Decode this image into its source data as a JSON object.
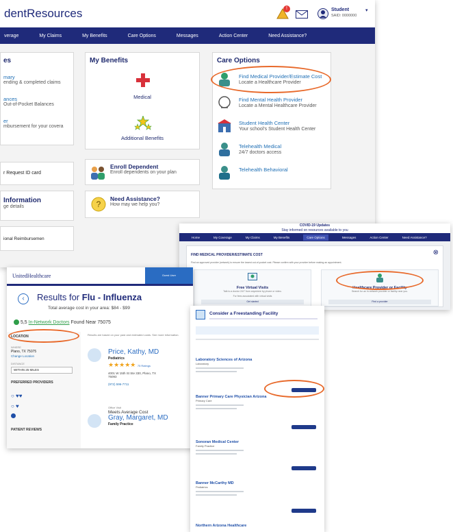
{
  "colors": {
    "navy": "#1f2a7a",
    "accent_orange": "#e8692a",
    "red_cross": "#d8313a",
    "green_stars": "#4aa83a"
  },
  "main": {
    "brand": "dentResources",
    "header": {
      "alert_badge": "!",
      "user_name": "Student",
      "user_id": "SAID: 0000000"
    },
    "nav": [
      "verage",
      "My Claims",
      "My Benefits",
      "Care Options",
      "Messages",
      "Action Center",
      "Need Assistance?"
    ],
    "left_col": {
      "heading": "es",
      "item1_title": "mary",
      "item1_sub": "ending & completed claims",
      "item2_title": "ances",
      "item2_sub": "Out-of-Pocket Balances",
      "item3_title": "er",
      "item3_sub": "mbursement for your covera",
      "id_card": "r Request ID card",
      "info_title": "Information",
      "info_sub": "ge details",
      "reimburse": "ional Reimbursemen"
    },
    "my_benefits": {
      "title": "My Benefits",
      "medical": "Medical",
      "additional": "Additional Benefits"
    },
    "enroll": {
      "title": "Enroll Dependent",
      "sub": "Enroll dependents on your plan"
    },
    "assist": {
      "title": "Need Assistance?",
      "sub": "How may we help you?"
    },
    "care_options": {
      "title": "Care Options",
      "items": [
        {
          "title": "Find Medical Provider/Estimate Cost",
          "sub": "Locate a Healthcare Provider"
        },
        {
          "title": "Find Mental Health Provider",
          "sub": "Locate a Mental Healthcare Provider"
        },
        {
          "title": "Student Health Center",
          "sub": "Your school's Student Health Center"
        },
        {
          "title": "Telehealth Medical",
          "sub": "24/7 doctors access"
        },
        {
          "title": "Telehealth Behavioral",
          "sub": ""
        }
      ]
    }
  },
  "modal": {
    "covid_title": "COVID-19 Updates",
    "covid_sub": "Stay informed on resources available to you",
    "nav": [
      "Home",
      "My Coverage",
      "My Claims",
      "My Benefits",
      "Care Options",
      "Messages",
      "Action Center",
      "Need Assistance?"
    ],
    "title": "FIND MEDICAL PROVIDER/ESTIMATE COST",
    "close": "⊗",
    "intro": "Find an approved provider (network) to ensure the lowest out-of-pocket cost. Please confirm with your provider before making an appointment.",
    "opt1": {
      "title": "Free Virtual Visits",
      "desc": "Talk to a doctor 24/7 from anywhere by phone or video.",
      "note": "For fees associated with virtual visits",
      "btn": "Get started"
    },
    "opt2": {
      "title": "Healthcare Provider or Facility",
      "desc": "Search for an in-network provider or facility near you.",
      "btn": "Find a provider"
    }
  },
  "search": {
    "logo": "UnitedHealthcare",
    "header_btn": "Guest User",
    "title": "Results for ",
    "query": "Flu - Influenza",
    "avg_cost": "Total average cost in your area: $84 - $99",
    "found_prefix": "5,5",
    "found_link": "In-Network Doctors",
    "found_suffix": " Found Near 75075",
    "location_label": "LOCATION",
    "where": "WHERE",
    "location_value": "Plano, TX 75075",
    "change_location": "Change Location",
    "distance_label": "DISTANCE",
    "distance_value": "WITHIN 25 MILES",
    "pref_label": "PREFERRED PROVIDERS",
    "patient_reviews": "PATIENT REVIEWS",
    "disclaimer": "Results are based on your past and estimated costs. See more information.",
    "doctor1": {
      "name": "Price, Kathy, MD",
      "specialty": "Pediatrics",
      "rating_count": "75 Ratings",
      "address": "4001 W 15th St Ste 330, Plano, TX 75093",
      "phone": "(972) 596-7711",
      "office": "Office Visit",
      "cost_label": "Meets Average Cost"
    },
    "doctor2": {
      "name": "Gray, Margaret, MD",
      "specialty": "Family Practice"
    }
  },
  "facility": {
    "title": "Consider a Freestanding Facility",
    "results": [
      {
        "name": "Laboratory Sciences of Arizona",
        "type": "Laboratory"
      },
      {
        "name": "Banner Primary Care Physician Arizona",
        "type": "Primary Care"
      },
      {
        "name": "Sonoran Medical Center",
        "type": "Family Practice"
      },
      {
        "name": "Banner McCarthy MD",
        "type": "Pediatrics"
      },
      {
        "name": "Northern Arizona Healthcare",
        "type": ""
      }
    ]
  }
}
